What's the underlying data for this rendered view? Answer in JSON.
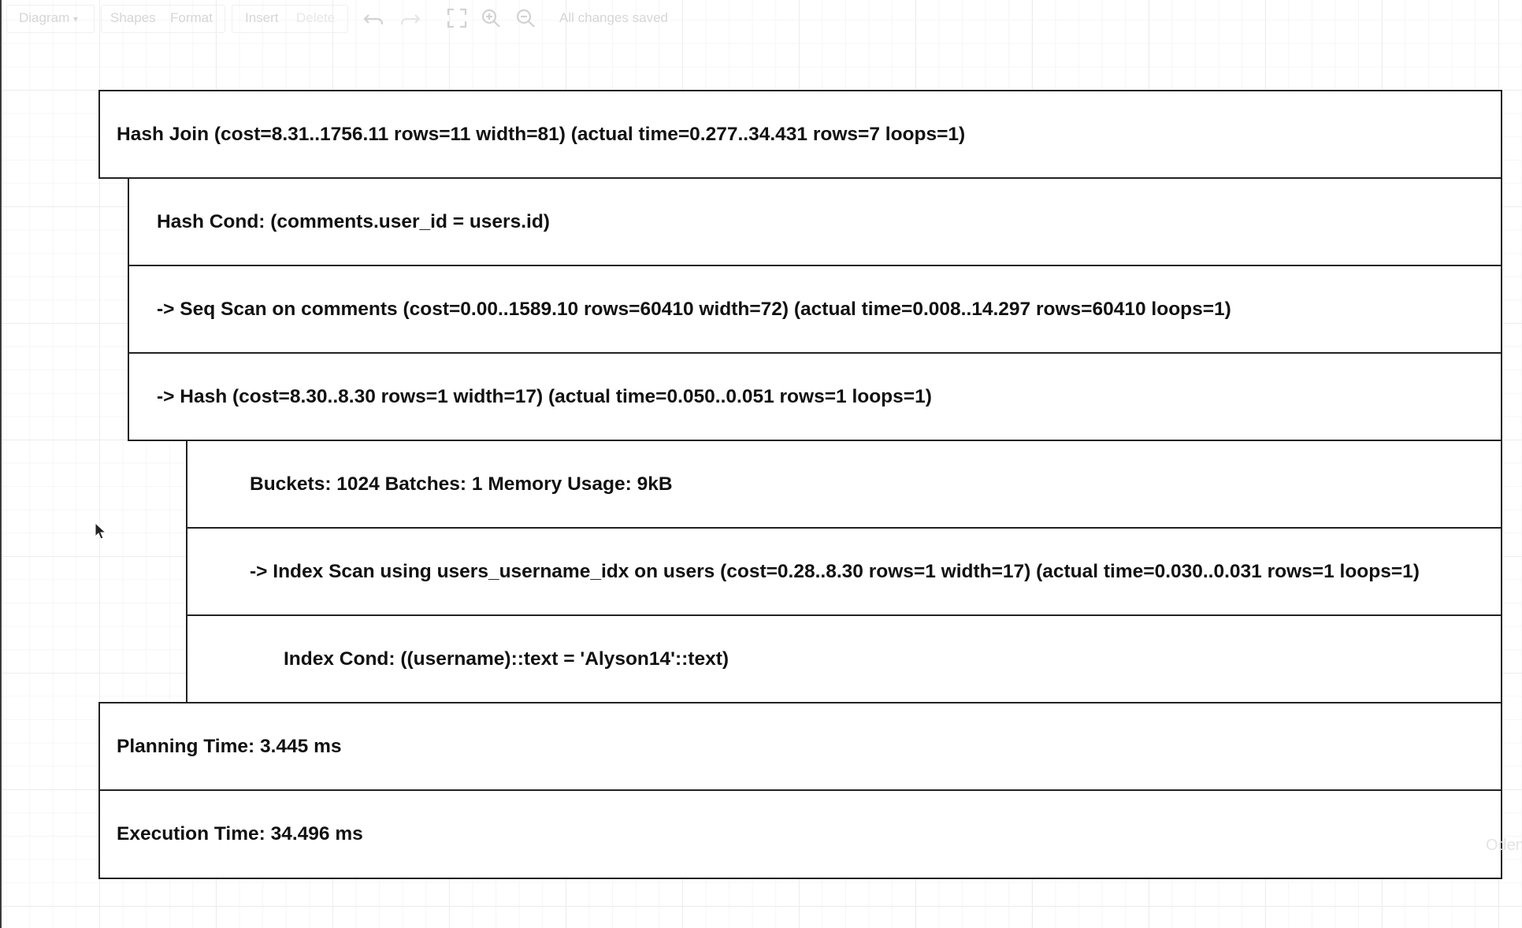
{
  "toolbar": {
    "diagram_menu": "Diagram",
    "shapes": "Shapes",
    "format": "Format",
    "insert": "Insert",
    "delete": "Delete",
    "status": "All changes saved",
    "icons": [
      "undo-icon",
      "redo-icon",
      "fullscreen-icon",
      "zoom-in-icon",
      "zoom-out-icon"
    ]
  },
  "plan": {
    "rows": [
      {
        "text": "Hash Join  (cost=8.31..1756.11 rows=11 width=81) (actual time=0.277..34.431 rows=7 loops=1)"
      },
      {
        "text": "Hash Cond: (comments.user_id = users.id)"
      },
      {
        "text": "->  Seq Scan on comments  (cost=0.00..1589.10 rows=60410 width=72) (actual time=0.008..14.297 rows=60410 loops=1)"
      },
      {
        "text": "->  Hash  (cost=8.30..8.30 rows=1 width=17) (actual time=0.050..0.051 rows=1 loops=1)"
      },
      {
        "text": "Buckets: 1024  Batches: 1  Memory Usage: 9kB"
      },
      {
        "text": "->  Index Scan using users_username_idx on users  (cost=0.28..8.30 rows=1 width=17) (actual time=0.030..0.031 rows=1 loops=1)"
      },
      {
        "text": "Index Cond: ((username)::text = 'Alyson14'::text)"
      },
      {
        "text": "Planning Time: 3.445 ms"
      },
      {
        "text": "Execution Time: 34.496 ms"
      }
    ]
  },
  "watermark": "Oden"
}
